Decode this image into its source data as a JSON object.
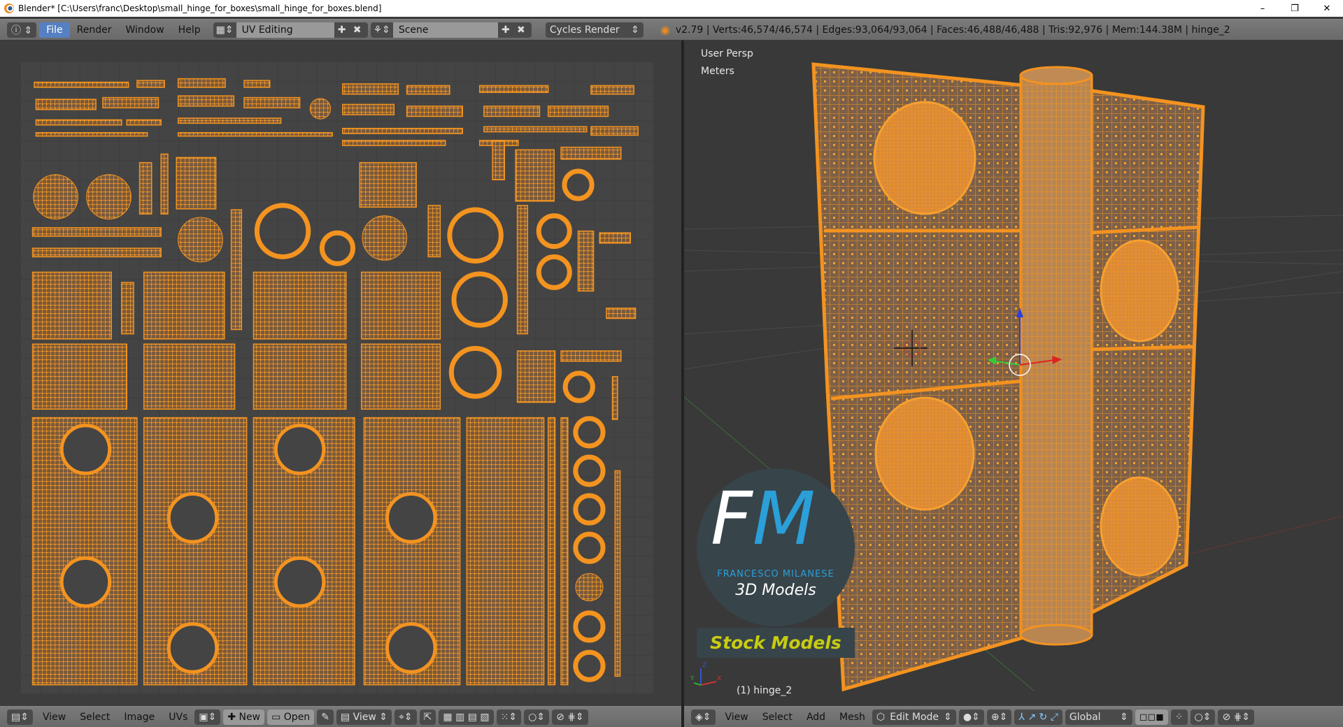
{
  "window": {
    "title": "Blender* [C:\\Users\\franc\\Desktop\\small_hinge_for_boxes\\small_hinge_for_boxes.blend]",
    "minimize": "–",
    "maximize": "❐",
    "close": "✕"
  },
  "info_header": {
    "menus": [
      "File",
      "Render",
      "Window",
      "Help"
    ],
    "active_menu": "File",
    "screen_layout": "UV Editing",
    "scene": "Scene",
    "render_engine": "Cycles Render",
    "stats": "v2.79 | Verts:46,574/46,574 | Edges:93,064/93,064 | Faces:46,488/46,488 | Tris:92,976 | Mem:144.38M | hinge_2"
  },
  "uv_header": {
    "menus": [
      "View",
      "Select",
      "Image",
      "UVs"
    ],
    "new_label": "New",
    "open_label": "Open",
    "view_label": "View"
  },
  "viewport": {
    "view_name": "User Persp",
    "units": "Meters",
    "object_label": "(1) hinge_2",
    "axes": [
      "X",
      "Y",
      "Z"
    ]
  },
  "viewport_header": {
    "menus": [
      "View",
      "Select",
      "Add",
      "Mesh"
    ],
    "mode": "Edit Mode",
    "orientation": "Global"
  },
  "watermark": {
    "initials_f": "F",
    "initials_m": "M",
    "name": "FRANCESCO MILANESE",
    "tagline": "3D Models",
    "banner": "Stock Models"
  },
  "colors": {
    "mesh_orange": "#f39320",
    "face_brown": "#7d6048",
    "accent_blue": "#2b9fd8",
    "banner_yellow": "#c8cc10",
    "logo_bg": "#37444a"
  }
}
